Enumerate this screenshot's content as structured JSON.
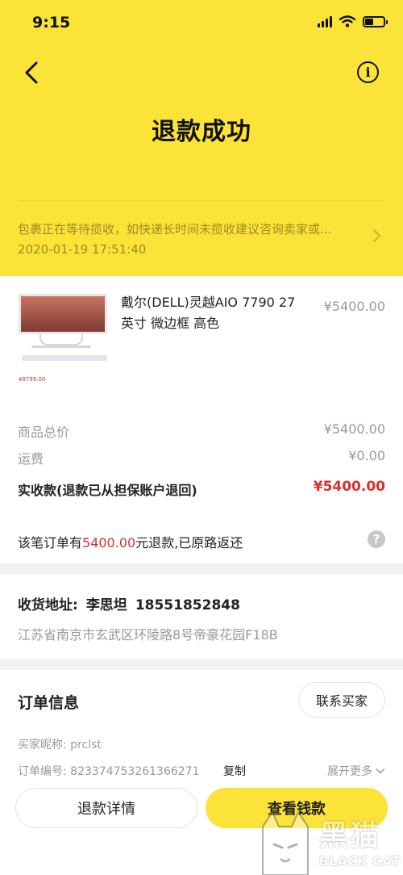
{
  "status_bar": {
    "time": "9:15",
    "battery_level": 0.45
  },
  "header": {
    "title": "退款成功",
    "tracking_message": "包裹正在等待揽收，如快递长时间未揽收建议咨询卖家或...",
    "tracking_time": "2020-01-19 17:51:40"
  },
  "product": {
    "name": "戴尔(DELL)灵越AIO 7790 27英寸 微边框 高色",
    "price": "¥5400.00",
    "image_promo_price": "¥8799.00"
  },
  "summary": {
    "subtotal_label": "商品总价",
    "subtotal_value": "¥5400.00",
    "shipping_label": "运费",
    "shipping_value": "¥0.00",
    "paid_label": "实收款(退款已从担保账户退回)",
    "paid_value": "¥5400.00"
  },
  "refund_notice": {
    "prefix": "该笔订单有",
    "amount": "5400.00",
    "suffix": "元退款,已原路返还"
  },
  "address": {
    "label": "收货地址:",
    "recipient": "李思坦",
    "phone": "18551852848",
    "detail": "江苏省南京市玄武区环陵路8号帝豪花园F18B"
  },
  "order_info": {
    "title": "订单信息",
    "contact_seller": "联系买家",
    "buyer_nickname": "买家昵称: prclst",
    "order_number": "订单编号: 823374753261366271",
    "copy": "复制",
    "expand": "展开更多"
  },
  "actions": {
    "refund_details": "退款详情",
    "view_money": "查看钱款"
  },
  "watermark": {
    "cn": "黑猫",
    "en": "BLACK CAT"
  },
  "colors": {
    "brand_yellow": "#fbe337",
    "price_red": "#d8312c",
    "muted_gray": "#999999"
  },
  "icons": [
    "back-arrow-icon",
    "info-icon",
    "chevron-right-icon",
    "help-icon",
    "chevron-down-icon",
    "signal-icon",
    "wifi-icon",
    "battery-icon"
  ]
}
